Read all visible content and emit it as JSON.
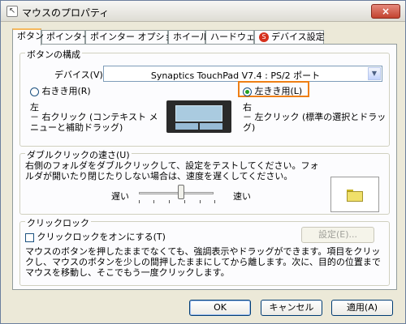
{
  "window": {
    "title": "マウスのプロパティ",
    "close_label": "×"
  },
  "tabs": [
    {
      "label": "ボタン"
    },
    {
      "label": "ポインター"
    },
    {
      "label": "ポインター オプション"
    },
    {
      "label": "ホイール"
    },
    {
      "label": "ハードウェア"
    },
    {
      "label": "デバイス設定"
    }
  ],
  "buttons_group": {
    "legend": "ボタンの構成",
    "device_label": "デバイス(V):",
    "device_value": "Synaptics TouchPad V7.4 : PS/2 ポート",
    "right_handed": "右きき用(R)",
    "left_handed": "左きき用(L)",
    "left_desc_title": "左",
    "left_desc": "－ 右クリック (コンテキスト メニューと補助ドラッグ)",
    "right_desc_title": "右",
    "right_desc": "－ 左クリック (標準の選択とドラッグ)"
  },
  "double_click": {
    "legend": "ダブルクリックの速さ(U)",
    "description": "右側のフォルダをダブルクリックして、設定をテストしてください。フォルダが開いたり閉じたりしない場合は、速度を遅くしてください。",
    "slow_label": "遅い",
    "fast_label": "速い",
    "slider_fraction": 0.55
  },
  "click_lock": {
    "legend": "クリックロック",
    "checkbox_label": "クリックロックをオンにする(T)",
    "settings_button": "設定(E)...",
    "description": "マウスのボタンを押したままでなくても、強調表示やドラッグができます。項目をクリックし、マウスのボタンを少しの間押したままにしてから離します。次に、目的の位置までマウスを移動し、そこでもう一度クリックします。"
  },
  "footer": {
    "ok": "OK",
    "cancel": "キャンセル",
    "apply": "適用(A)"
  }
}
